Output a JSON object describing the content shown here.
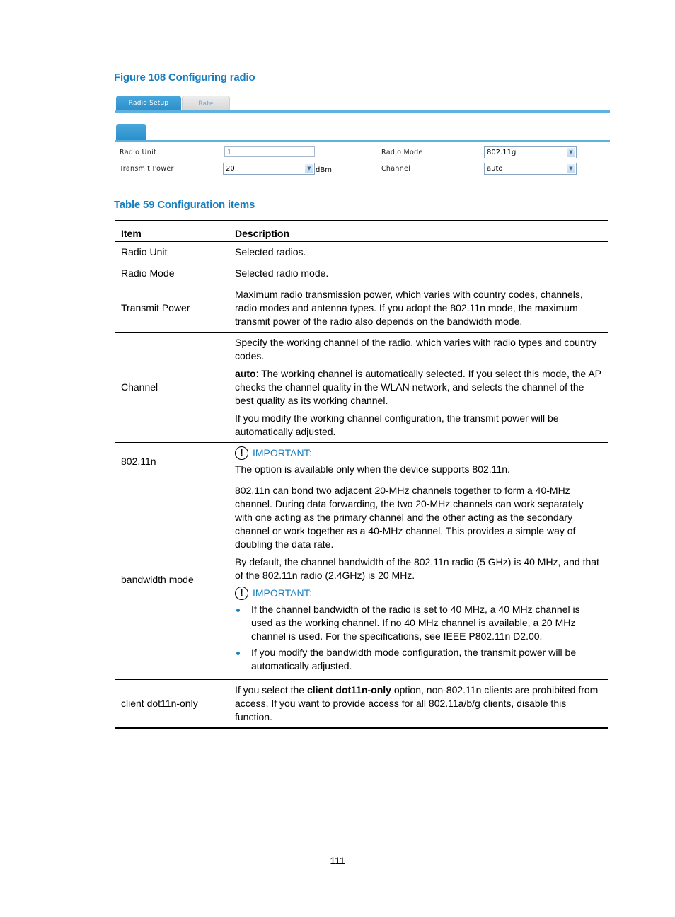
{
  "figure": {
    "caption": "Figure 108 Configuring radio",
    "tabs": [
      {
        "label": "Radio Setup",
        "active": true
      },
      {
        "label": "Rate",
        "active": false
      }
    ],
    "fields": {
      "radio_unit": {
        "label": "Radio Unit",
        "value": "1"
      },
      "transmit_power": {
        "label": "Transmit Power",
        "value": "20",
        "unit": "dBm"
      },
      "radio_mode": {
        "label": "Radio Mode",
        "value": "802.11g"
      },
      "channel": {
        "label": "Channel",
        "value": "auto"
      }
    },
    "colors": {
      "accent": "#2b8fcb",
      "tab_line": "#5fb2e0"
    }
  },
  "table": {
    "caption": "Table 59 Configuration items",
    "headers": {
      "item": "Item",
      "description": "Description"
    },
    "rows": [
      {
        "item": "Radio Unit",
        "desc": [
          "Selected radios."
        ]
      },
      {
        "item": "Radio Mode",
        "desc": [
          "Selected radio mode."
        ]
      },
      {
        "item": "Transmit Power",
        "desc": [
          "Maximum radio transmission power, which varies with country codes, channels, radio modes and antenna types. If you adopt the 802.11n mode, the maximum transmit power of the radio also depends on the bandwidth mode."
        ]
      },
      {
        "item": "Channel",
        "desc": [
          "Specify the working channel of the radio, which varies with radio types and country codes.",
          {
            "bold": "auto",
            "rest": ": The working channel is automatically selected. If you select this mode, the AP checks the channel quality in the WLAN network, and selects the channel of the best quality as its working channel."
          },
          "If you modify the working channel configuration, the transmit power will be automatically adjusted."
        ]
      },
      {
        "item": "802.11n",
        "important_label": "IMPORTANT:",
        "important_text": "The option is available only when the device supports 802.11n."
      },
      {
        "item": "bandwidth mode",
        "desc": [
          "802.11n can bond two adjacent 20-MHz channels together to form a 40-MHz channel. During data forwarding, the two 20-MHz channels can work separately with one acting as the primary channel and the other acting as the secondary channel or work together as a 40-MHz channel. This provides a simple way of doubling the data rate.",
          "By default, the channel bandwidth of the 802.11n radio (5 GHz) is 40 MHz, and that of the 802.11n radio (2.4GHz) is 20 MHz."
        ],
        "important_label": "IMPORTANT:",
        "bullets": [
          "If the channel bandwidth of the radio is set to 40 MHz, a 40 MHz channel is used as the working channel. If no 40 MHz channel is available, a 20 MHz channel is used. For the specifications, see IEEE P802.11n D2.00.",
          "If you modify the bandwidth mode configuration, the transmit power will be automatically adjusted."
        ]
      },
      {
        "item": "client dot11n-only",
        "desc_pre": "If you select the ",
        "desc_bold": "client dot11n-only",
        "desc_post": " option, non-802.11n clients are prohibited from access. If you want to provide access for all 802.11a/b/g clients, disable this function."
      }
    ],
    "important_icon": "!"
  },
  "page_number": "111"
}
